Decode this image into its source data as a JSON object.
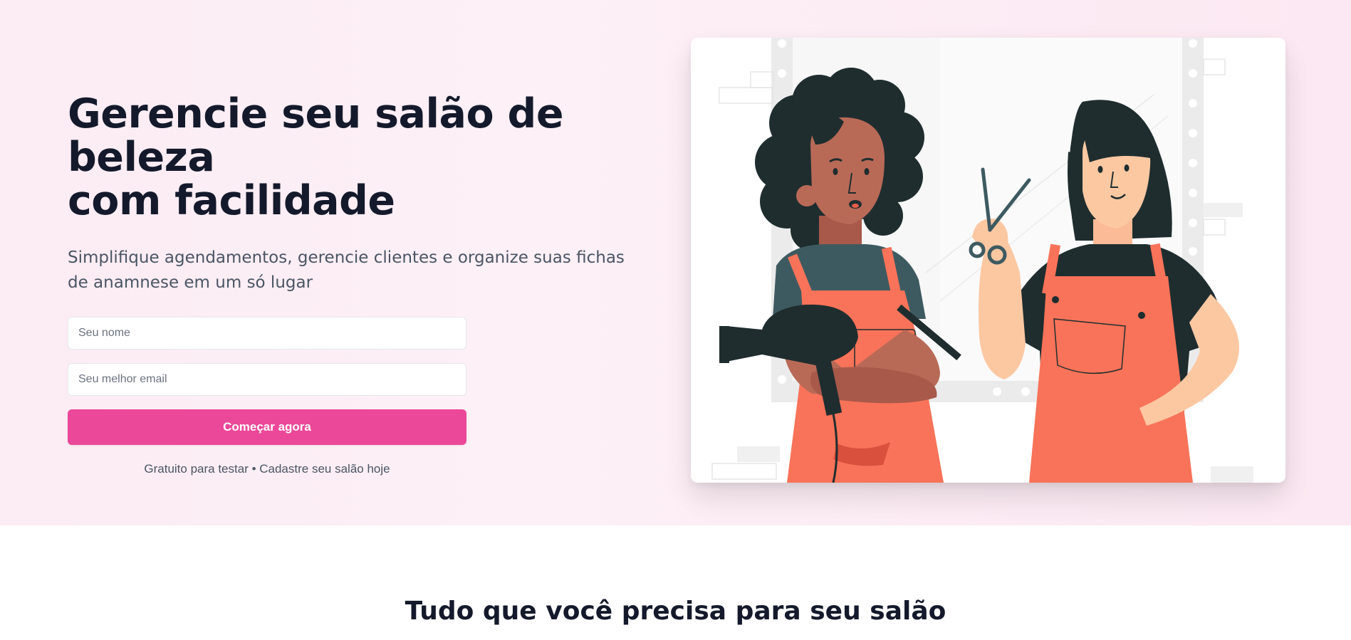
{
  "hero": {
    "title_line1": "Gerencie seu salão de beleza",
    "title_line2": "com facilidade",
    "subtitle": "Simplifique agendamentos, gerencie clientes e organize suas fichas de anamnese em um só lugar",
    "form": {
      "name_placeholder": "Seu nome",
      "email_placeholder": "Seu melhor email",
      "submit_label": "Começar agora",
      "note": "Gratuito para testar • Cadastre seu salão hoje"
    },
    "illustration": "two-hairdressers-illustration"
  },
  "features": {
    "title": "Tudo que você precisa para seu salão"
  },
  "colors": {
    "accent": "#ec4899",
    "hero_bg": "#fcecf4",
    "apron": "#f87359",
    "dark": "#1f2d2f"
  }
}
